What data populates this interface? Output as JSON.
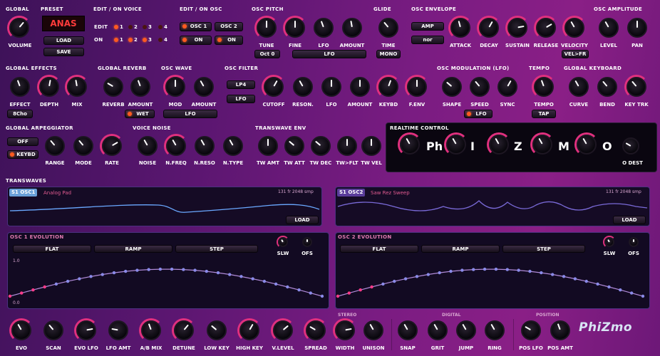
{
  "sections": {
    "global": "GLOBAL",
    "preset": "PRESET",
    "edit_voice": "EDIT / ON  VOICE",
    "edit_osc": "EDIT / ON  OSC",
    "osc_pitch": "OSC PITCH",
    "glide": "GLIDE",
    "osc_env": "OSC ENVELOPE",
    "osc_amp": "OSC AMPLITUDE",
    "global_effects": "GLOBAL EFFECTS",
    "global_reverb": "GLOBAL REVERB",
    "osc_wave": "OSC WAVE",
    "osc_filter": "OSC FILTER",
    "osc_mod": "OSC MODULATION (LFO)",
    "tempo": "TEMPO",
    "global_keyboard": "GLOBAL KEYBOARD",
    "global_arp": "GLOBAL ARPEGGIATOR",
    "voice_noise": "VOICE NOISE",
    "transwave_env": "TRANSWAVE ENV",
    "realtime": "REALTIME  CONTROL",
    "transwaves": "TRANSWAVES"
  },
  "preset": {
    "name": "ANAS",
    "load": "LOAD",
    "save": "SAVE"
  },
  "voice": {
    "edit": "EDIT",
    "on": "ON",
    "n1": "1",
    "n2": "2",
    "n3": "3",
    "n4": "4"
  },
  "osc": {
    "osc1": "OSC 1",
    "osc2": "OSC 2",
    "on": "ON"
  },
  "labels": {
    "volume": "VOLUME",
    "tune": "TUNE",
    "fine": "FINE",
    "lfo": "LFO",
    "amount": "AMOUNT",
    "time": "TIME",
    "attack": "ATTACK",
    "decay": "DECAY",
    "sustain": "SUSTAIN",
    "release": "RELEASE",
    "velocity": "VELOCITY",
    "level": "LEVEL",
    "pan": "PAN",
    "effect": "EFFECT",
    "depth": "DEPTH",
    "mix": "MIX",
    "reverb": "REVERB",
    "mod": "MOD",
    "cutoff": "CUTOFF",
    "reson": "RESON.",
    "keybd": "KEYBD",
    "fenv": "F.ENV",
    "shape": "SHAPE",
    "speed": "SPEED",
    "sync": "SYNC",
    "tempo": "TEMPO",
    "curve": "CURVE",
    "bend": "BEND",
    "keytrk": "KEY TRK",
    "range": "RANGE",
    "mode": "MODE",
    "rate": "RATE",
    "noise": "NOISE",
    "nfreq": "N.FREQ",
    "nreso": "N.RESO",
    "ntype": "N.TYPE",
    "twamt": "TW AMT",
    "twatt": "TW ATT",
    "twdec": "TW DEC",
    "twflt": "TW>FLT",
    "twvel": "TW VEL",
    "odest": "O DEST"
  },
  "buttons": {
    "oct": "Oct 0",
    "lfo": "LFO",
    "mono": "MONO",
    "amp": "AMP",
    "nor": "nor",
    "velfr": "VEL>FR",
    "effect8": "8Cho",
    "wet": "WET",
    "wave_lfo": "LFO",
    "lp4": "LP4",
    "flfo": "LFO",
    "mod_lfo": "LFO",
    "tap": "TAP",
    "arp_off": "OFF",
    "arp_keybd": "KEYBD"
  },
  "realtime": [
    "Ph",
    "I",
    "Z",
    "M",
    "O"
  ],
  "wave1": {
    "tag": "S1 OSC1",
    "name": "Analog Pad",
    "info": "131 fr   2048 smp",
    "load": "LOAD"
  },
  "wave2": {
    "tag": "S1 OSC2",
    "name": "Saw Rez Sweep",
    "info": "131 fr   2048 smp",
    "load": "LOAD"
  },
  "evo1": {
    "title": "OSC 1 EVOLUTION",
    "flat": "FLAT",
    "ramp": "RAMP",
    "step": "STEP",
    "slw": "SLW",
    "ofs": "OFS",
    "y1": "1.0",
    "y0": "0.0"
  },
  "evo2": {
    "title": "OSC 2 EVOLUTION",
    "flat": "FLAT",
    "ramp": "RAMP",
    "step": "STEP",
    "slw": "SLW",
    "ofs": "OFS"
  },
  "bottom": {
    "evo": "EVO",
    "scan": "SCAN",
    "evolfo": "EVO LFO",
    "lfoamt": "LFO AMT",
    "abmix": "A/B MIX",
    "detune": "DETUNE",
    "lowkey": "LOW KEY",
    "highkey": "HIGH KEY",
    "vlevel": "V.LEVEL",
    "spread": "SPREAD",
    "width": "WIDTH",
    "unison": "UNISON",
    "snap": "SNAP",
    "grit": "GRIT",
    "jump": "JUMP",
    "ring": "RING",
    "poslfo": "POS LFO",
    "posamt": "POS AMT",
    "stereo": "STEREO",
    "digital": "DIGITAL",
    "position": "POSITION"
  },
  "logo": "PhiZmo",
  "colors": {
    "accent": "#e0307e",
    "led": "#ff5a20",
    "preset_text": "#ff3b3b"
  }
}
